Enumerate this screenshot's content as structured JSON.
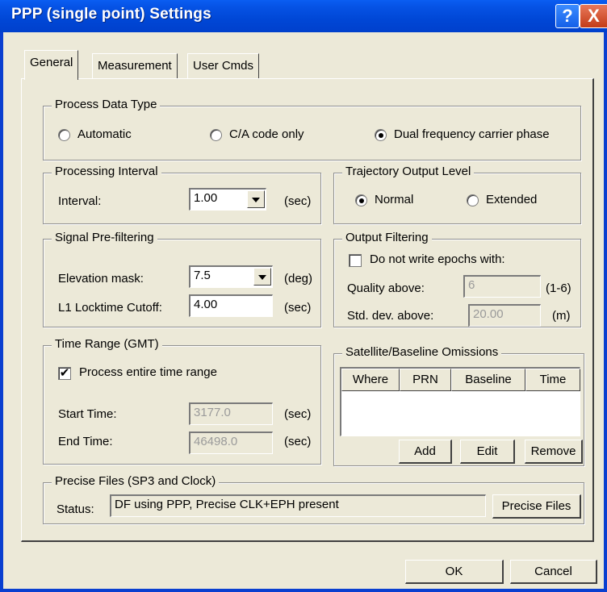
{
  "window": {
    "title": "PPP (single point) Settings",
    "help_label": "?",
    "close_label": "X"
  },
  "tabs": [
    "General",
    "Measurement",
    "User Cmds"
  ],
  "process_data_type": {
    "title": "Process Data Type",
    "options": [
      "Automatic",
      "C/A code only",
      "Dual frequency carrier phase"
    ],
    "selected": "Dual frequency carrier phase"
  },
  "processing_interval": {
    "title": "Processing Interval",
    "interval_label": "Interval:",
    "interval_value": "1.00",
    "interval_unit": "(sec)"
  },
  "trajectory_output": {
    "title": "Trajectory Output Level",
    "options": [
      "Normal",
      "Extended"
    ],
    "selected": "Normal"
  },
  "signal_prefiltering": {
    "title": "Signal Pre-filtering",
    "elevation_label": "Elevation mask:",
    "elevation_value": "7.5",
    "elevation_unit": "(deg)",
    "locktime_label": "L1 Locktime Cutoff:",
    "locktime_value": "4.00",
    "locktime_unit": "(sec)"
  },
  "output_filtering": {
    "title": "Output Filtering",
    "checkbox_label": "Do not write epochs with:",
    "checkbox_checked": false,
    "quality_label": "Quality above:",
    "quality_value": "6",
    "quality_unit": "(1-6)",
    "stddev_label": "Std. dev. above:",
    "stddev_value": "20.00",
    "stddev_unit": "(m)"
  },
  "time_range": {
    "title": "Time Range (GMT)",
    "checkbox_label": "Process entire time range",
    "checkbox_checked": true,
    "start_label": "Start Time:",
    "start_value": "3177.0",
    "start_unit": "(sec)",
    "end_label": "End Time:",
    "end_value": "46498.0",
    "end_unit": "(sec)"
  },
  "omissions": {
    "title": "Satellite/Baseline Omissions",
    "columns": [
      "Where",
      "PRN",
      "Baseline",
      "Time"
    ],
    "add_label": "Add",
    "edit_label": "Edit",
    "remove_label": "Remove"
  },
  "precise_files": {
    "title": "Precise Files (SP3 and Clock)",
    "status_label": "Status:",
    "status_value": "DF using PPP, Precise CLK+EPH present",
    "button_label": "Precise Files"
  },
  "footer": {
    "ok_label": "OK",
    "cancel_label": "Cancel"
  },
  "colors": {
    "titlebar": "#0047d6",
    "dialog_bg": "#ece9d8",
    "close_button": "#c43c18"
  },
  "icons": {
    "help": "help-icon",
    "close": "close-icon",
    "dropdown": "chevron-down-icon"
  }
}
